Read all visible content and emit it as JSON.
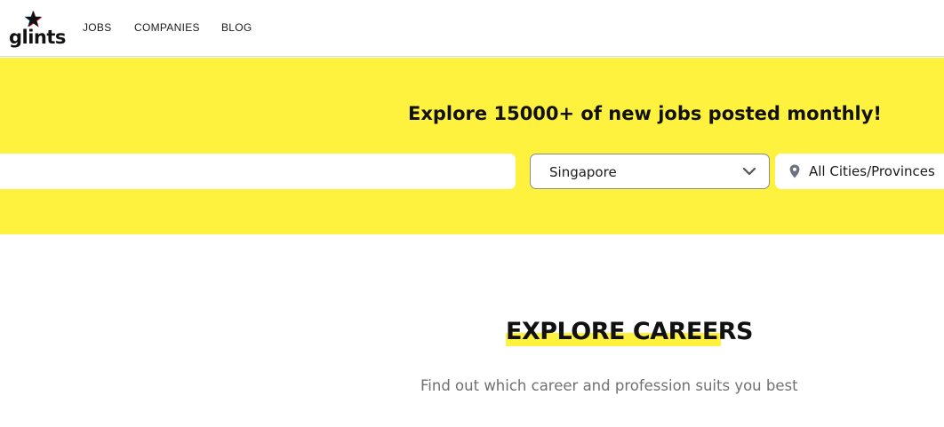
{
  "brand": {
    "name": "glints",
    "accent": "#fff23f"
  },
  "nav": {
    "items": [
      {
        "label": "JOBS"
      },
      {
        "label": "COMPANIES"
      },
      {
        "label": "BLOG"
      }
    ]
  },
  "hero": {
    "headline_prefix": "Explore ",
    "headline_count": "15000+",
    "headline_suffix": " of new jobs posted monthly!",
    "search": {
      "value": ""
    },
    "country_select": {
      "value": "Singapore",
      "icon": "chevron-down-icon"
    },
    "city_select": {
      "value": "All Cities/Provinces",
      "icon": "map-pin-icon"
    }
  },
  "careers": {
    "title": "EXPLORE CAREERS",
    "subtitle": "Find out which career and profession suits you best"
  }
}
